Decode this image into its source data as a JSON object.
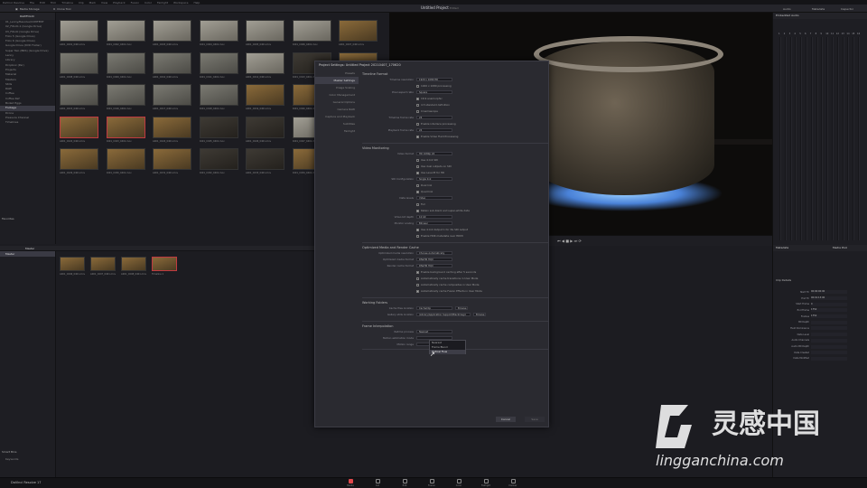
{
  "menubar": {
    "items": [
      "DaVinci Resolve",
      "File",
      "Edit",
      "Trim",
      "Timeline",
      "Clip",
      "Mark",
      "View",
      "Playback",
      "Fusion",
      "Color",
      "Fairlight",
      "Workspace",
      "Help"
    ]
  },
  "toolbar": {
    "media_storage": "Media Storage",
    "clone_tool": "Clone Tool",
    "project_title": "Untitled Project",
    "project_state": "Edited",
    "audio": "Audio",
    "metadata": "Metadata",
    "inspector": "Inspector",
    "timecode_left": "00:00:00:00",
    "timecode_right": "00:00:00:00"
  },
  "tree": {
    "header": "RAWFOLIO",
    "items": [
      "01_Lenny/Resolve/CONTENT",
      "02_FOLIO-1 (Google Drive)",
      "03_FOLIO (Google Drive)",
      "Folio 5 (Google Drive)",
      "Folio 6 (Google Drive)",
      "Google Drive (DVD Folder)",
      "Super Two (BRS) (Google Drive)",
      "Lenny",
      "Library",
      "Dropbox (Per)",
      "Projects",
      "Material",
      "Masters",
      "Stills",
      "RAW",
      "Coffee",
      "Coffee Ref",
      "Boiled Eggs",
      "Footage",
      "Drone",
      "Pressure Channel",
      "Timelines"
    ],
    "selected": 18,
    "favorites": "Favorites",
    "smart_bins": "Smart Bins",
    "keywords": "Keywords"
  },
  "clips": [
    "A001_C001_0401.mov",
    "A001_C002_0401.mov",
    "A001_C003_0401.mov",
    "A001_C004_0401.mov",
    "A001_C005_0401.mov",
    "A001_C006_0401.mov",
    "A001_C007_0401.mov",
    "A001_C008_0401.mov",
    "A001_C009_0401.mov",
    "A001_C010_0401.mov",
    "A001_C011_0401.mov",
    "A001_C012_0401.mov",
    "A001_C013_0401.mov",
    "A001_C014_0401.mov",
    "A001_C015_0401.mov",
    "A001_C016_0401.mov",
    "A001_C017_0401.mov",
    "A001_C018_0401.mov",
    "A001_C019_0401.mov",
    "A001_C020_0401.mov",
    "A001_C021_0401.mov",
    "A001_C022_0401.mov",
    "A001_C023_0401.mov",
    "A001_C024_0401.mov",
    "A001_C025_0401.mov",
    "A001_C026_0401.mov",
    "A001_C027_0401.mov",
    "A001_C028_0401.mov",
    "A001_C029_0401.mov",
    "A001_C030_0401.mov",
    "A001_C031_0401.mov",
    "A001_C032_0401.mov",
    "A001_C033_0401.mov",
    "A001_C034_0401.mov",
    "A001_C035_0401.mov"
  ],
  "pool": {
    "master_label": "Master",
    "bin_label": "Master",
    "clips": [
      "A001_C006_0401.mov",
      "A001_C007_0401.mov",
      "A001_C008_0401.mov",
      "Timeline 1"
    ]
  },
  "dialog": {
    "title": "Project Settings: Untitled Project 20210407_170620",
    "sidebar": [
      "Presets",
      "Master Settings",
      "Image Scaling",
      "Color Management",
      "General Options",
      "Camera RAW",
      "Capture and Playback",
      "Subtitles",
      "Fairlight"
    ],
    "selected": 1,
    "timeline_format_heading": "Timeline Format",
    "rows1": [
      {
        "label": "Timeline resolution",
        "value": "1920 x 1080 HD"
      },
      {
        "label": "",
        "value": "1920   x   1080   processing"
      },
      {
        "label": "Pixel aspect ratio",
        "value": "Square"
      },
      {
        "label": "",
        "value": "16:9 anamorphic"
      },
      {
        "label": "",
        "value": "4:3 standard definition"
      },
      {
        "label": "",
        "value": "Cinemascope"
      },
      {
        "label": "Timeline frame rate",
        "value": "24"
      },
      {
        "label": "",
        "value": "Enable interlace processing"
      },
      {
        "label": "Playback frame rate",
        "value": "24"
      },
      {
        "label": "",
        "value": "Enable Video Field Processing"
      }
    ],
    "video_monitoring_heading": "Video Monitoring",
    "rows2": [
      {
        "label": "Video format",
        "value": "HD 1080p 24"
      },
      {
        "label": "",
        "value": "Use 4:4:4 SDI"
      },
      {
        "label": "",
        "value": "Use dual outputs on SDI"
      },
      {
        "label": "",
        "value": "Use Level B for HD"
      },
      {
        "label": "SDI Configuration",
        "value": "Single link"
      },
      {
        "label": "",
        "value": "Dual link"
      },
      {
        "label": "",
        "value": "Quad link"
      },
      {
        "label": "Data levels",
        "value": "Video"
      },
      {
        "label": "",
        "value": "Full"
      },
      {
        "label": "",
        "value": "Retain sub-black and super-white data"
      },
      {
        "label": "Video bit depth",
        "value": "10 bit"
      },
      {
        "label": "Monitor scaling",
        "value": "Bilinear"
      },
      {
        "label": "",
        "value": "Use 4:4:4 Output 1 for 3G SDI output"
      },
      {
        "label": "",
        "value": "Enable HDR metadata over HDMI"
      }
    ],
    "optimized_heading": "Optimized Media and Render Cache",
    "rows3": [
      {
        "label": "Optimized media resolution",
        "value": "Choose Automatically"
      },
      {
        "label": "Optimized media format",
        "value": "DNxHR HQX"
      },
      {
        "label": "Render cache format",
        "value": "DNxHR HQX"
      },
      {
        "label": "",
        "value": "Enable background caching after 5 seconds"
      },
      {
        "label": "",
        "value": "Automatically cache transitions in User Mode"
      },
      {
        "label": "",
        "value": "Automatically cache composites in User Mode"
      },
      {
        "label": "",
        "value": "Automatically cache Fusion Effects in User Mode"
      }
    ],
    "working_heading": "Working Folders",
    "rows4": [
      {
        "label": "Cache files location",
        "value": "CacheClip",
        "btn": "Browse"
      },
      {
        "label": "Gallery stills location",
        "value": "/Library/Application Support/Blackmagic",
        "btn": "Browse"
      }
    ],
    "frame_heading": "Frame Interpolation",
    "rows5": [
      {
        "label": "Retime process",
        "value": "Nearest"
      },
      {
        "label": "Motion estimation mode",
        "value": ""
      },
      {
        "label": "Motion range",
        "value": ""
      }
    ],
    "dropdown": [
      "Nearest",
      "Frame Blend",
      "Optical Flow"
    ],
    "dropdown_selected": 2,
    "cancel": "Cancel",
    "save": "Save"
  },
  "right": {
    "header": "Embedded Audio",
    "tabs": [
      "Video",
      "Metadata"
    ],
    "meter_labels": [
      "1",
      "2",
      "3",
      "4",
      "5",
      "6",
      "7",
      "8",
      "9",
      "10",
      "11",
      "12",
      "13",
      "14",
      "15",
      "16"
    ],
    "metadata_title": "Metadata",
    "media_pool_tab": "Media Pool",
    "clip_info": [
      "Timeline 1",
      "00:00:00:00",
      "1920 x 1080",
      "24",
      "00:01:13",
      "1:1"
    ],
    "clip_details": "Clip Details",
    "fields": [
      "Start TC",
      "End TC",
      "Start Frame",
      "End Frame",
      "Frames",
      "Bit Depth",
      "Field Dominance",
      "Data Level",
      "Audio Channels",
      "Audio Bit Depth",
      "Date Created",
      "Date Modified"
    ],
    "values": [
      "00:00:00:00",
      "00:01:13:00",
      "0",
      "1752",
      "1752",
      "",
      "",
      "",
      "",
      "",
      "",
      ""
    ]
  },
  "pages": [
    "Media",
    "Cut",
    "Edit",
    "Fusion",
    "Color",
    "Fairlight",
    "Deliver"
  ],
  "active_page": 0,
  "app_name": "DaVinci Resolve 17",
  "watermark": {
    "brand": "灵感中国",
    "url": "lingganchina.com"
  }
}
